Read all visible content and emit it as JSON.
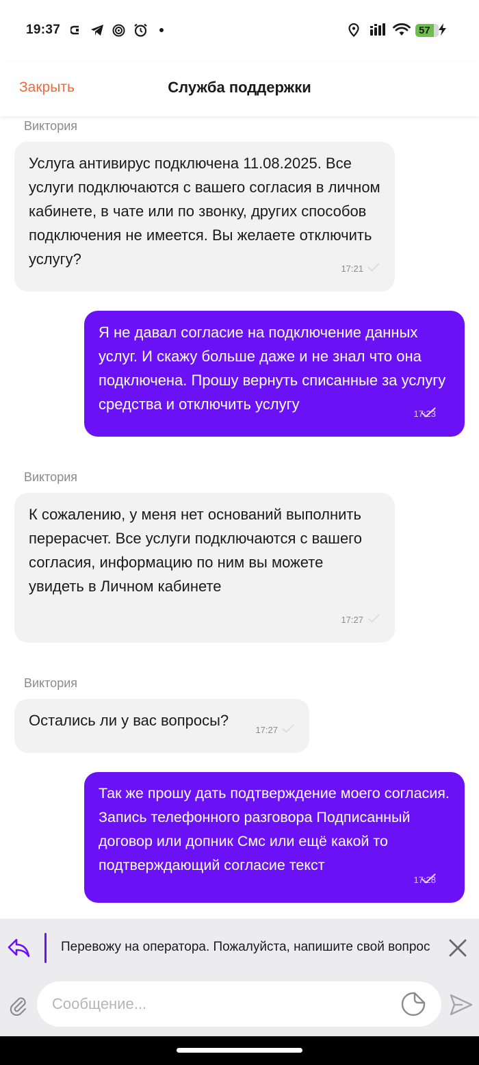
{
  "status_bar": {
    "time": "19:37",
    "left_icons": [
      "screen-record-icon",
      "telegram-icon",
      "target-icon",
      "alarm-icon",
      "dot-icon"
    ],
    "right_icons": [
      "location-icon",
      "signal-icon",
      "wifi-icon"
    ],
    "battery": "57"
  },
  "header": {
    "close_label": "Закрыть",
    "title": "Служба поддержки"
  },
  "messages": [
    {
      "direction": "in",
      "sender": "Виктория",
      "text": "Услуга антивирус подключена 11.08.2025. Все услуги подключаются с вашего согласия в личном кабинете, в чате или по звонку, других способов подключения не имеется. Вы желаете отключить услугу?",
      "time": "17:21"
    },
    {
      "direction": "out",
      "text": "Я не давал согласие на подключение данных услуг. И скажу больше даже и не знал что она подключена. Прошу вернуть списанные за услугу средства и отключить услугу",
      "time": "17:23"
    },
    {
      "direction": "in",
      "sender": "Виктория",
      "text": "К сожалению, у меня нет оснований выполнить перерасчет. Все услуги подключаются с вашего согласия, информацию по ним вы можете увидеть в Личном кабинете",
      "time": "17:27"
    },
    {
      "direction": "in",
      "sender": "Виктория",
      "text": "Остались ли у вас вопросы?",
      "time": "17:27"
    },
    {
      "direction": "out",
      "text": "Так же прошу дать подтверждение моего согласия. Запись телефонного разговора Подписанный договор или допник Смс или ещё какой то подтверждающий согласие текст",
      "time": "17:28"
    }
  ],
  "reply": {
    "text": "Перевожу на оператора. Пожалуйста, напишите свой вопрос"
  },
  "composer": {
    "placeholder": "Сообщение..."
  },
  "colors": {
    "accent_orange": "#ef6a3a",
    "outgoing_bubble": "#6a12f5",
    "incoming_bubble": "#f2f2f3",
    "battery_green": "#6cc04a"
  }
}
